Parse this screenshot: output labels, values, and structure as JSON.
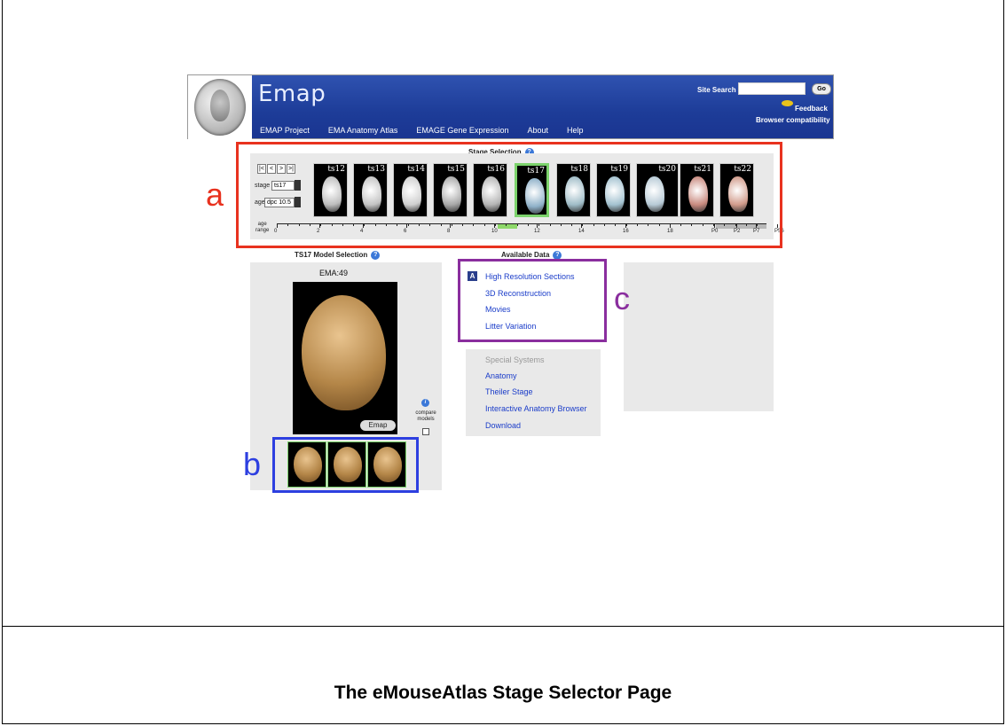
{
  "header": {
    "brand": "Emap",
    "nav": [
      "EMAP Project",
      "EMA Anatomy Atlas",
      "EMAGE Gene Expression",
      "About",
      "Help"
    ],
    "site_search_label": "Site Search",
    "site_search_value": "",
    "go_label": "Go",
    "feedback": "Feedback",
    "browser_compat": "Browser compatibility"
  },
  "stage_selection": {
    "title": "Stage Selection",
    "nav_arrows": [
      "|<",
      "<",
      ">",
      ">|"
    ],
    "stage_label": "stage",
    "stage_value": "ts17",
    "age_label": "age",
    "age_value": "dpc 10.5",
    "thumbnails": [
      {
        "label": "ts12",
        "color": "#bdbdbd"
      },
      {
        "label": "ts13",
        "color": "#c4c4c4"
      },
      {
        "label": "ts14",
        "color": "#cfcfcf"
      },
      {
        "label": "ts15",
        "color": "#a8a8a8"
      },
      {
        "label": "ts16",
        "color": "#b5b5b5"
      },
      {
        "label": "ts17",
        "color": "#8fb1c9",
        "selected": true
      },
      {
        "label": "ts18",
        "color": "#9fbcc7"
      },
      {
        "label": "ts19",
        "color": "#a3c2d0"
      },
      {
        "label": "ts20",
        "color": "#b7cad6"
      },
      {
        "label": "ts21",
        "color": "#c98a7f"
      },
      {
        "label": "ts22",
        "color": "#d19b8b"
      }
    ],
    "age_range_label_1": "age",
    "age_range_label_2": "range",
    "ruler_labels": [
      "0",
      "2",
      "4",
      "6",
      "8",
      "10",
      "12",
      "14",
      "16",
      "18",
      "P0",
      "P2",
      "P7",
      "P56"
    ]
  },
  "model_selection": {
    "title": "TS17 Model Selection",
    "ema_id": "EMA:49",
    "emap_badge": "Emap",
    "compare_label": "compare models"
  },
  "available_data": {
    "title": "Available Data",
    "a_icon": "A",
    "items": [
      "High Resolution Sections",
      "3D Reconstruction",
      "Movies",
      "Litter Variation"
    ],
    "special_title": "Special Systems",
    "special_items": [
      "Anatomy",
      "Theiler Stage",
      "Interactive Anatomy Browser",
      "Download"
    ]
  },
  "annotations": {
    "a": {
      "letter": "a",
      "color": "#e8321f"
    },
    "b": {
      "letter": "b",
      "color": "#2d3fe0"
    },
    "c": {
      "letter": "c",
      "color": "#8a2e9e"
    }
  },
  "caption": "The eMouseAtlas Stage Selector Page"
}
